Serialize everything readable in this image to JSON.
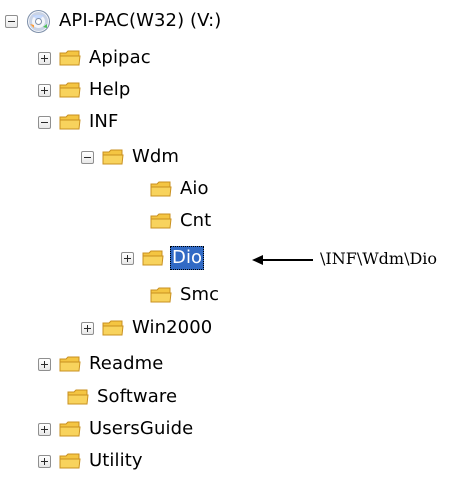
{
  "tree": {
    "root": {
      "label": "API-PAC(W32) (V:)",
      "icon": "cd-drive-icon",
      "toggle": "minus"
    },
    "apipac": {
      "label": "Apipac",
      "icon": "folder-icon",
      "toggle": "plus"
    },
    "help": {
      "label": "Help",
      "icon": "folder-icon",
      "toggle": "plus"
    },
    "inf": {
      "label": "INF",
      "icon": "folder-icon",
      "toggle": "minus"
    },
    "wdm": {
      "label": "Wdm",
      "icon": "folder-icon",
      "toggle": "minus"
    },
    "aio": {
      "label": "Aio",
      "icon": "folder-icon",
      "toggle": "none"
    },
    "cnt": {
      "label": "Cnt",
      "icon": "folder-icon",
      "toggle": "none"
    },
    "dio": {
      "label": "Dio",
      "icon": "folder-icon",
      "toggle": "plus",
      "selected": true
    },
    "smc": {
      "label": "Smc",
      "icon": "folder-icon",
      "toggle": "none"
    },
    "win2000": {
      "label": "Win2000",
      "icon": "folder-icon",
      "toggle": "plus"
    },
    "readme": {
      "label": "Readme",
      "icon": "folder-icon",
      "toggle": "plus"
    },
    "software": {
      "label": "Software",
      "icon": "folder-icon",
      "toggle": "none"
    },
    "usersguide": {
      "label": "UsersGuide",
      "icon": "folder-icon",
      "toggle": "plus"
    },
    "utility": {
      "label": "Utility",
      "icon": "folder-icon",
      "toggle": "plus"
    }
  },
  "annotation": {
    "path": "\\INF\\Wdm\\Dio",
    "icon": "left-arrow-icon"
  },
  "colors": {
    "selection": "#316ac5",
    "folder": "#f5c542",
    "folder_shadow": "#d89c1f"
  }
}
